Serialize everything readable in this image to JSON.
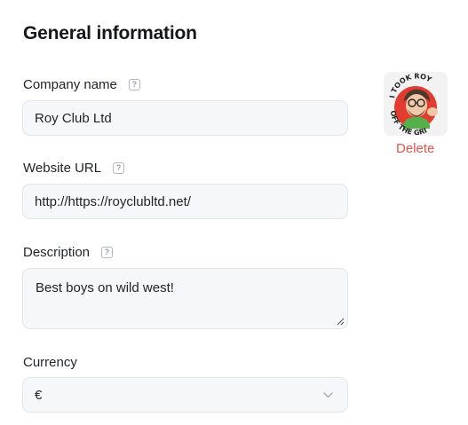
{
  "section": {
    "title": "General information"
  },
  "company": {
    "label": "Company name",
    "value": "Roy Club Ltd"
  },
  "website": {
    "label": "Website URL",
    "value": "http://https://royclubltd.net/"
  },
  "description": {
    "label": "Description",
    "value": "Best boys on wild west!"
  },
  "currency": {
    "label": "Currency",
    "value": "€"
  },
  "avatar": {
    "delete_label": "Delete",
    "image_text": "I TOOK ROY OFF THE GRID"
  },
  "help_icon_glyph": "?",
  "colors": {
    "delete": "#e0584c",
    "input_bg": "#f6f7f9",
    "input_border": "#e3e5e9"
  }
}
